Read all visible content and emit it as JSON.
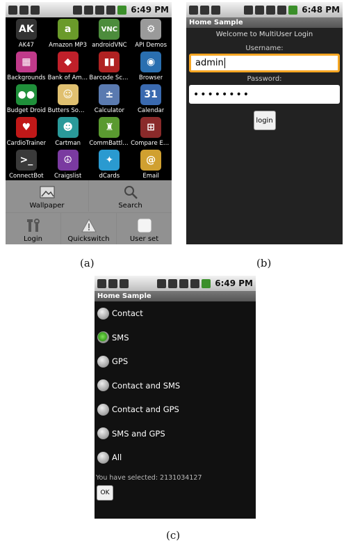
{
  "status_bar": {
    "time_a": "6:49 PM",
    "time_b": "6:48 PM",
    "time_c": "6:49 PM"
  },
  "panel_a": {
    "apps": [
      {
        "label": "AK47",
        "icon": "ak47-icon",
        "color": "#333333",
        "glyph": "AK"
      },
      {
        "label": "Amazon MP3",
        "icon": "amazon-mp3-icon",
        "color": "#6a9a2a",
        "glyph": "a"
      },
      {
        "label": "androidVNC",
        "icon": "vnc-icon",
        "color": "#4c8c3c",
        "glyph": "VNC"
      },
      {
        "label": "API Demos",
        "icon": "folder-icon",
        "color": "#9a9a9a",
        "glyph": "⚙"
      },
      {
        "label": "Backgrounds",
        "icon": "backgrounds-icon",
        "color": "#c03a8a",
        "glyph": "▦"
      },
      {
        "label": "Bank of Ame...",
        "icon": "bank-icon",
        "color": "#c0202a",
        "glyph": "◆"
      },
      {
        "label": "Barcode Sca...",
        "icon": "barcode-icon",
        "color": "#b02222",
        "glyph": "▮▮"
      },
      {
        "label": "Browser",
        "icon": "browser-icon",
        "color": "#2a6fb0",
        "glyph": "◉"
      },
      {
        "label": "Budget Droid",
        "icon": "budget-icon",
        "color": "#1f8f3a",
        "glyph": "●●"
      },
      {
        "label": "Butters Soun...",
        "icon": "butters-icon",
        "color": "#e0c070",
        "glyph": "☺"
      },
      {
        "label": "Calculator",
        "icon": "calculator-icon",
        "color": "#5a7ab0",
        "glyph": "±"
      },
      {
        "label": "Calendar",
        "icon": "calendar-icon",
        "color": "#3a6ab0",
        "glyph": "31"
      },
      {
        "label": "CardioTrainer",
        "icon": "heart-icon",
        "color": "#c01818",
        "glyph": "♥"
      },
      {
        "label": "Cartman",
        "icon": "cartman-icon",
        "color": "#2a9a9a",
        "glyph": "☻"
      },
      {
        "label": "CommBattle...",
        "icon": "android-icon",
        "color": "#5a9a30",
        "glyph": "♜"
      },
      {
        "label": "Compare Ev...",
        "icon": "shopping-cart-icon",
        "color": "#8a2a2a",
        "glyph": "⊞"
      },
      {
        "label": "ConnectBot",
        "icon": "terminal-icon",
        "color": "#3a3a3a",
        "glyph": ">_"
      },
      {
        "label": "Craigslist",
        "icon": "peace-icon",
        "color": "#7a3aa0",
        "glyph": "☮"
      },
      {
        "label": "dCards",
        "icon": "cards-icon",
        "color": "#2a9ad0",
        "glyph": "✦"
      },
      {
        "label": "Email",
        "icon": "email-icon",
        "color": "#d0a030",
        "glyph": "@"
      }
    ],
    "launcher": {
      "wallpaper_label": "Wallpaper",
      "search_label": "Search",
      "login_label": "Login",
      "quickswitch_label": "Quickswitch",
      "user_set_label": "User set"
    }
  },
  "panel_b": {
    "title": "Home Sample",
    "welcome": "Welcome to MultiUser Login",
    "username_label": "Username:",
    "username_value": "admin",
    "password_label": "Password:",
    "password_value": "••••••••",
    "login_button": "login"
  },
  "panel_c": {
    "title": "Home Sample",
    "options": [
      {
        "label": "Contact",
        "checked": false
      },
      {
        "label": "SMS",
        "checked": true
      },
      {
        "label": "GPS",
        "checked": false
      },
      {
        "label": "Contact and SMS",
        "checked": false
      },
      {
        "label": "Contact and GPS",
        "checked": false
      },
      {
        "label": "SMS and GPS",
        "checked": false
      },
      {
        "label": "All",
        "checked": false
      }
    ],
    "selected_text": "You have selected: 2131034127",
    "ok_button": "OK"
  },
  "captions": {
    "a": "(a)",
    "b": "(b)",
    "c": "(c)"
  }
}
